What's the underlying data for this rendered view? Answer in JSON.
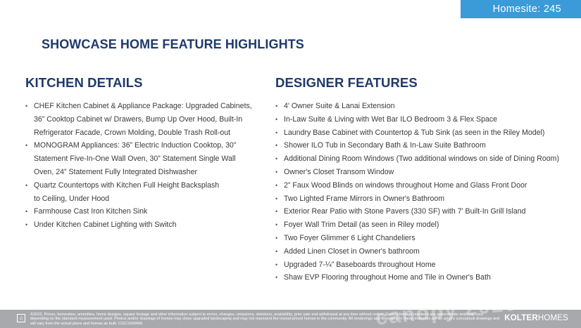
{
  "header": {
    "homesite_label": "Homesite: 245"
  },
  "page_title": "SHOWCASE HOME FEATURE HIGHLIGHTS",
  "kitchen": {
    "heading": "KITCHEN DETAILS",
    "items": [
      "CHEF Kitchen Cabinet & Appliance Package: Upgraded Cabinets,\n36” Cooktop Cabinet w/ Drawers, Bump Up Over Hood, Built-In\nRefrigerator Facade, Crown Molding, Double Trash Roll-out",
      "MONOGRAM Appliances: 36” Electric Induction Cooktop, 30”\nStatement Five-In-One Wall Oven, 30” Statement Single Wall\nOven, 24” Statement Fully Integrated Dishwasher",
      "Quartz Countertops with Kitchen Full Height Backsplash\n to Ceiling, Under Hood",
      "Farmhouse Cast Iron Kitchen Sink",
      "Under Kitchen Cabinet Lighting with Switch"
    ]
  },
  "designer": {
    "heading": "DESIGNER FEATURES",
    "items": [
      "4' Owner Suite & Lanai Extension",
      "In-Law Suite & Living with Wet Bar ILO Bedroom 3 & Flex Space",
      "Laundry Base Cabinet with Countertop & Tub Sink (as seen in the Riley Model)",
      "Shower ILO Tub in Secondary Bath & In-Law Suite Bathroom",
      "Additional Dining Room Windows (Two additional windows on side of Dining Room)",
      "Owner's Closet Transom Window",
      "2” Faux Wood Blinds on windows throughout Home and Glass Front Door",
      "Two Lighted Frame Mirrors in Owner's Bathroom",
      "Exterior Rear Patio with Stone Pavers (330 SF) with 7' Built-In Grill Island",
      "Foyer Wall Trim Detail (as seen in Riley model)",
      "Two Foyer Glimmer 6 Light Chandeliers",
      "Added Linen Closet in Owner's bathroom",
      "Upgraded 7-¼” Baseboards throughout Home",
      "Shaw EVP Flooring throughout Home and Tile in Owner's Bath"
    ]
  },
  "footer": {
    "disclaimer": "©2022. Prices, homesites, amenities, home designs, square footage and other information subject to errors, changes, omissions, deletions, availability, prior sale and withdrawal at any time without notice. Square footage numbers are approximate and may vary depending on the standard measurement used. Photos and/or drawings of homes may show upgraded landscaping and may not represent the lowest-priced homes in the community. All renderings and floorplans in these materials are an artist's conceptual drawings and will vary from the actual plans and homes as built. CGC1509406",
    "logo_bold": "KOLTER",
    "logo_light": "HOMES",
    "equal_housing_icon": "equal-housing-icon"
  },
  "watermark_text": "canopy 2020"
}
